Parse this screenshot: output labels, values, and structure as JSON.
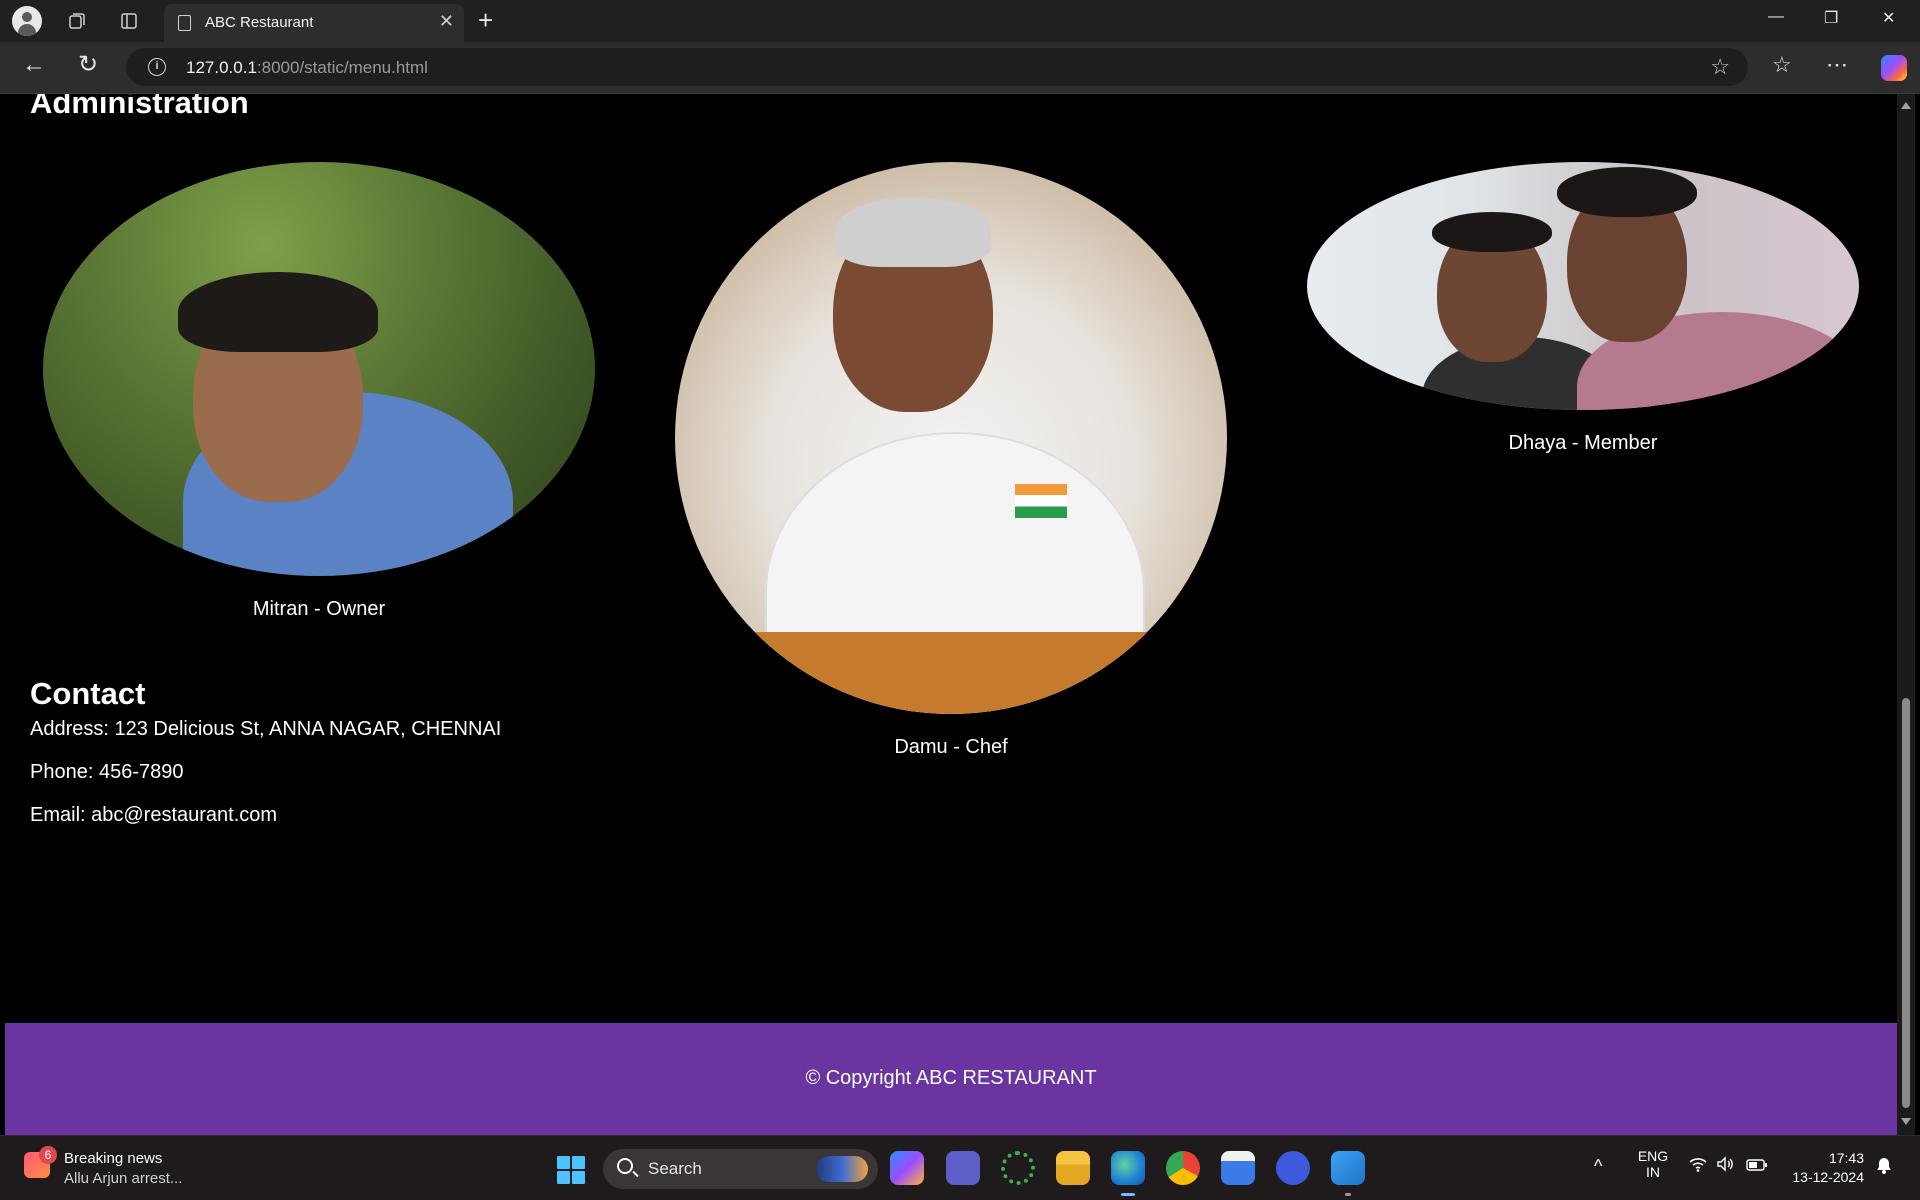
{
  "browser": {
    "tab_title": "ABC Restaurant",
    "tab_close": "✕",
    "new_tab": "+",
    "url_host": "127.0.0.1",
    "url_rest": ":8000/static/menu.html",
    "window_controls": {
      "minimize": "—",
      "maximize": "❐",
      "close": "✕"
    },
    "nav": {
      "back": "←",
      "reload": "↻"
    },
    "right_icons": {
      "favorite": "☆",
      "favorites": "☆",
      "more": "⋯"
    }
  },
  "page": {
    "administration_heading": "Administration",
    "members": [
      {
        "caption": "Mitran - Owner"
      },
      {
        "caption": "Damu - Chef"
      },
      {
        "caption": "Dhaya - Member"
      }
    ],
    "contact_heading": "Contact",
    "address": "Address: 123 Delicious St, ANNA NAGAR, CHENNAI",
    "phone": "Phone: 456-7890",
    "email": "Email: abc@restaurant.com",
    "footer_text": "© Copyright ABC RESTAURANT"
  },
  "taskbar": {
    "news_badge": "6",
    "news_title": "Breaking news",
    "news_subtitle": "Allu Arjun arrest...",
    "search_label": "Search",
    "lang_line1": "ENG",
    "lang_line2": "IN",
    "time": "17:43",
    "date": "13-12-2024",
    "chevron": "^"
  },
  "colors": {
    "footer_bg": "#6a35a0",
    "page_bg": "#000000",
    "accent_taskbar": "#4cc2ff"
  }
}
